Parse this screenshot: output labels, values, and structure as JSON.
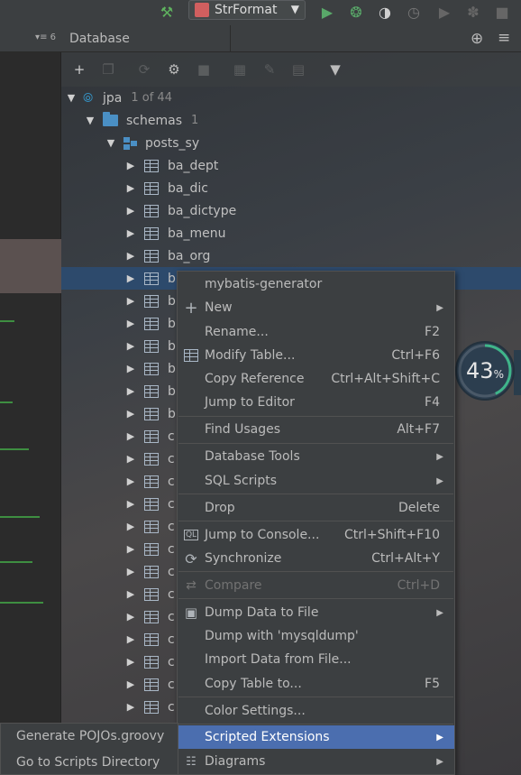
{
  "toolbar": {
    "run_config_label": "StrFormat",
    "icons": [
      "build-hammer-icon",
      "run-icon",
      "debug-icon",
      "coverage-icon",
      "profile-icon",
      "run-disabled-icon",
      "attach-icon",
      "stop-icon"
    ]
  },
  "left_panel": {
    "header_mini": "▾≡ 6"
  },
  "database": {
    "title": "Database",
    "toolbar_icons": [
      "add-icon",
      "copy-icon",
      "refresh-icon",
      "properties-icon",
      "stop-icon",
      "table-editor-icon",
      "edit-icon",
      "console-icon",
      "filter-icon"
    ],
    "header_icons": [
      "crosshair-icon",
      "pin-settings-icon"
    ]
  },
  "tree": {
    "root": {
      "label": "jpa",
      "count": "1 of 44"
    },
    "schemas": {
      "label": "schemas",
      "count": "1"
    },
    "schema": {
      "label": "posts_sy"
    },
    "tables": [
      "ba_dept",
      "ba_dic",
      "ba_dictype",
      "ba_menu",
      "ba_org",
      "b",
      "b",
      "b",
      "b",
      "b",
      "b",
      "b",
      "c",
      "c",
      "c",
      "c",
      "c",
      "c",
      "c",
      "c",
      "c",
      "c",
      "c",
      "c",
      "c",
      "c"
    ]
  },
  "context_menu": {
    "items": [
      {
        "label": "mybatis-generator",
        "shortcut": ""
      },
      {
        "label": "New",
        "shortcut": "",
        "submenu": true
      },
      {
        "label": "Rename...",
        "shortcut": "F2"
      },
      {
        "label": "Modify Table...",
        "shortcut": "Ctrl+F6"
      },
      {
        "label": "Copy Reference",
        "shortcut": "Ctrl+Alt+Shift+C"
      },
      {
        "label": "Jump to Editor",
        "shortcut": "F4"
      },
      {
        "label": "Find Usages",
        "shortcut": "Alt+F7"
      },
      {
        "label": "Database Tools",
        "shortcut": "",
        "submenu": true
      },
      {
        "label": "SQL Scripts",
        "shortcut": "",
        "submenu": true
      },
      {
        "label": "Drop",
        "shortcut": "Delete"
      },
      {
        "label": "Jump to Console...",
        "shortcut": "Ctrl+Shift+F10"
      },
      {
        "label": "Synchronize",
        "shortcut": "Ctrl+Alt+Y"
      },
      {
        "label": "Compare",
        "shortcut": "Ctrl+D",
        "disabled": true
      },
      {
        "label": "Dump Data to File",
        "shortcut": "",
        "submenu": true
      },
      {
        "label": "Dump with 'mysqldump'",
        "shortcut": ""
      },
      {
        "label": "Import Data from File...",
        "shortcut": ""
      },
      {
        "label": "Copy Table to...",
        "shortcut": "F5"
      },
      {
        "label": "Color Settings...",
        "shortcut": ""
      },
      {
        "label": "Scripted Extensions",
        "shortcut": "",
        "submenu": true,
        "highlighted": true
      },
      {
        "label": "Diagrams",
        "shortcut": "",
        "submenu": true
      }
    ]
  },
  "scripted_submenu": {
    "items": [
      {
        "label": "Generate POJOs.groovy"
      },
      {
        "label": "Go to Scripts Directory"
      }
    ]
  },
  "memory_indicator": {
    "value": "43",
    "unit": "%",
    "fraction": 0.43,
    "color": "#3fb58a"
  }
}
